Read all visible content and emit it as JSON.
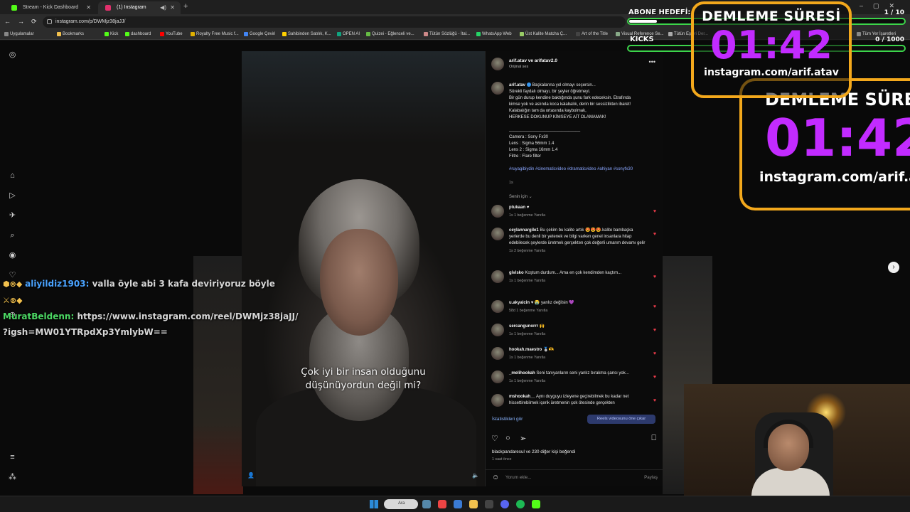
{
  "browser": {
    "tabs": [
      {
        "label": "Stream - Kick Dashboard",
        "color": "#53fc18"
      },
      {
        "label": "(1) Instagram",
        "color": "#e1306c"
      }
    ],
    "url": "instagram.com/p/DWMjz38jaJJ/",
    "bookmarks": [
      "Uygulamalar",
      "Bookmarks",
      "Kick",
      "dashboard",
      "YouTube",
      "Royalty Free Music f...",
      "Google Çeviri",
      "Sahibinden Satılık, K...",
      "OPEN AI",
      "Quizei - Eğlenceli ve...",
      "Tütün Sözlüğü - İtal...",
      "WhatsApp Web",
      "Üst Kalite Matcha Ç...",
      "Art of the Title",
      "Visual Reference Se...",
      "Tütün Eşleri Der...",
      "Tüm Yer İşaretleri"
    ]
  },
  "post": {
    "header_name": "arif.atav ve arifatav2.0",
    "header_sub": "Orijinal ses",
    "caption_user": "arif.atav",
    "caption_lines": [
      "Başkalarına yol olmayı seçersin...",
      "Sürekli faydalı olmayı, bir şeyler öğretmeyi.",
      "Bir gün durup kendine baktığında şunu fark edeceksin. Etrafında",
      "kimse yok ve aslında koca kalabalık, derin bir sessizlikten ibaret!",
      "Kalabalığın tam da ortasında kaybolmak,",
      "HERKESE DOKUNUP KİMSEYE AİT OLAMAMAK!",
      "",
      "______________________________",
      "Camera : Sony Fx30",
      "Lens : Sigma 56mm 1.4",
      "Lens 2 : Sigma 16mm 1.4",
      "Filtre : Flare filter",
      ""
    ],
    "tags": "#ruyagibiydin #cinematicvideo #dramaticvideo #ahiyan #sonyfx30",
    "caption_time": "1s",
    "for_you": "Senin için ⌄",
    "subtitle": [
      "Çok iyi bir insan olduğunu",
      "düşünüyordun değil mi?"
    ],
    "comments": [
      {
        "user": "ptukaan",
        "text": "♥",
        "meta": "1s   1 beğenme   Yanıtla"
      },
      {
        "user": "ceylannargile1",
        "text": "Bu çekim bu kalite artık 😍😍😍.kalite bambaşka yerlerde bu denli bir yetenek ve bilgi varken genel insanlara hitap edebilecek şeylerde üretmek gerçekten çok değerli umarım devamı gelir",
        "meta": "1s   2 beğenme   Yanıtla"
      },
      {
        "user": "givisko",
        "text": "Koştum durdum... Ama en çok kendimden kaçtım...",
        "meta": "1s   1 beğenme   Yanıtla"
      },
      {
        "user": "u.akyalcin",
        "text": "♥ 😭 yanlız değilsin 💜",
        "meta": "58d   1 beğenme   Yanıtla"
      },
      {
        "user": "sercangunorrr",
        "text": "🙌",
        "meta": "1s   1 beğenme   Yanıtla"
      },
      {
        "user": "hookah.maestro",
        "text": "🥈🫶",
        "meta": "1s   1 beğenme   Yanıtla"
      },
      {
        "user": "_melihookah",
        "text": "Seni tanıyanların seni yanlız bırakma şansı yok...",
        "meta": "1s   1 beğenme   Yanıtla"
      },
      {
        "user": "mshookah__",
        "text": "Aynı duyguyu izleyene geçirebilmek bu kadar net hissettirebilmek içerik üretmenin çok ötesinde gerçekten",
        "meta": ""
      }
    ],
    "stats_link": "İstatistikleri gör",
    "promote_label": "Reels videosunu öne çıkar",
    "likes": "blackpandaresul ve 230 diğer kişi beğendi",
    "post_time": "1 saat önce",
    "comment_placeholder": "Yorum ekle...",
    "share_label": "Paylaş"
  },
  "overlay": {
    "chat": [
      {
        "user": "aliyildiz1903:",
        "text": "valla öyle abi 3 kafa deviriyoruz böyle"
      },
      {
        "user": "MuratBeldenn:",
        "text": "https://www.instagram.com/reel/DWMjz38jaJJ/ ?igsh=MW01YTRpdXp3YmlybW=="
      }
    ],
    "goal_sub_label": "ABONE HEDEFİ:",
    "goal_sub_count": "1 / 10",
    "goal_sub_progress": 0.1,
    "goal_kicks_label": "KICKS",
    "goal_kicks_count": "0 / 1000",
    "goal_kicks_progress": 0.0,
    "timer_title": "DEMLEME SÜRESİ",
    "timer_value": "01:42",
    "timer_url": "instagram.com/arif.atav",
    "timer_title_cut": "DEMLEME SÜRE",
    "timer_url_cut": "instagram.com/arif.a"
  },
  "taskbar": {
    "search": "Ara"
  },
  "colors": {
    "accent_orange": "#f3a81c",
    "timer_purple": "#c22bff",
    "goal_green": "#3cd44a",
    "heart_red": "#ee3b4a"
  }
}
